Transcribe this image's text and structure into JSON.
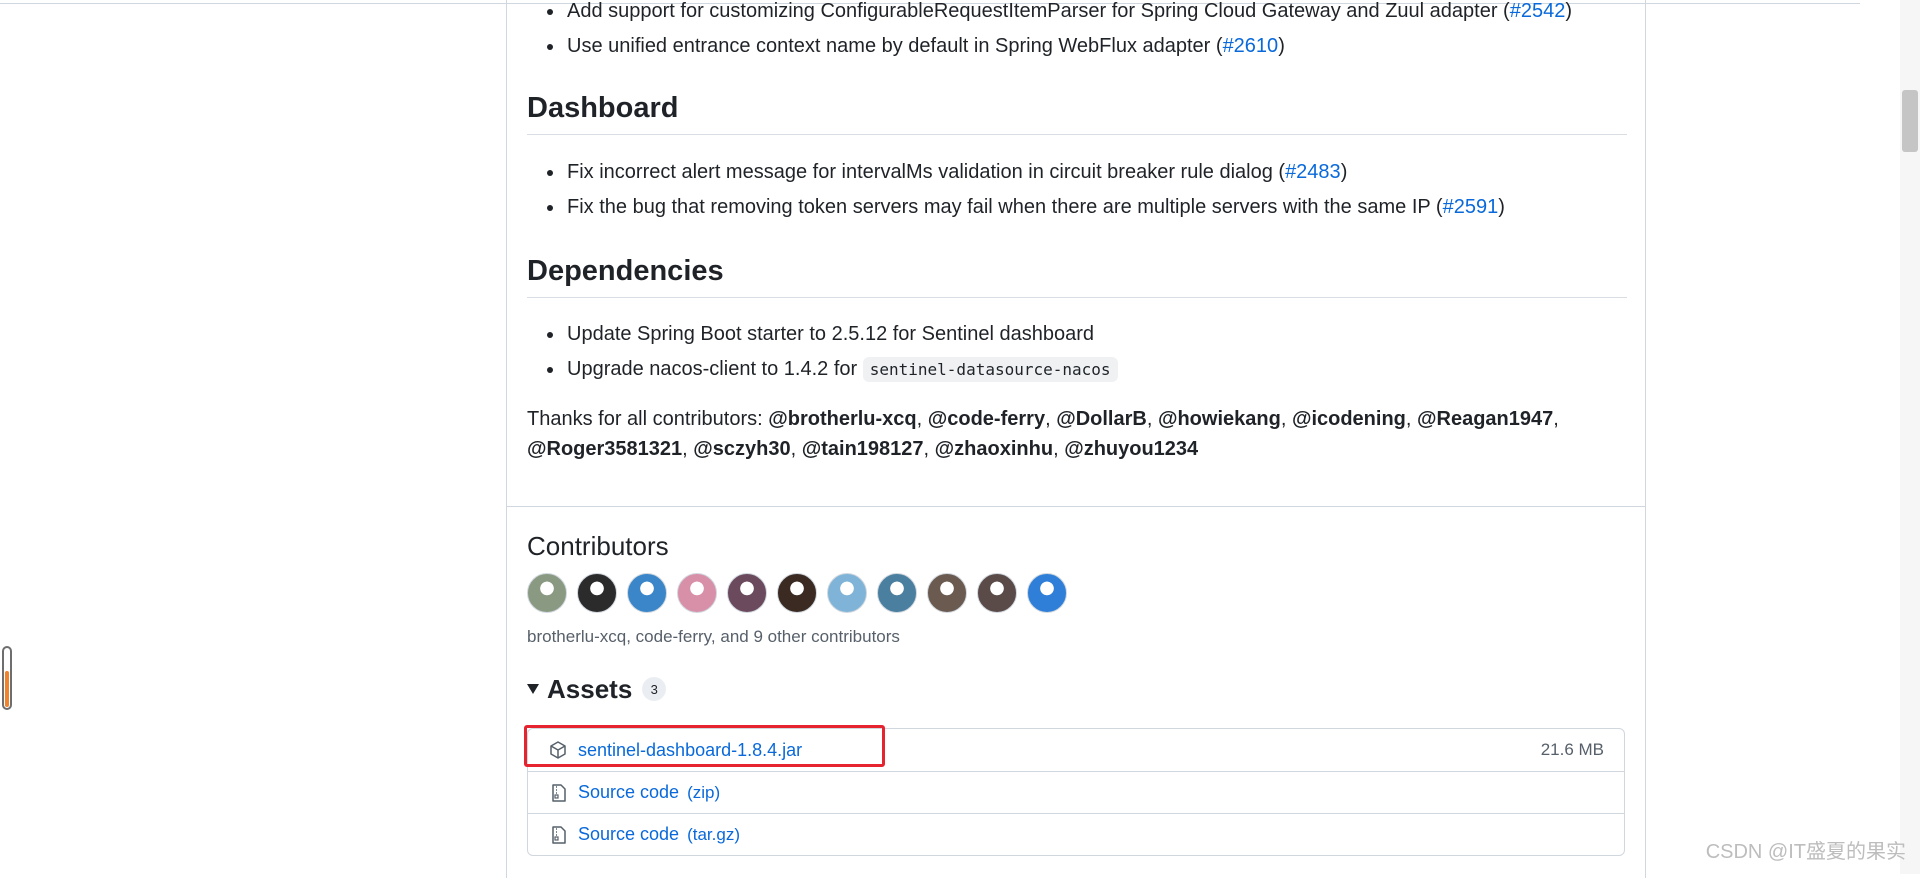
{
  "top_notes": [
    {
      "text": "Add support for customizing ConfigurableRequestItemParser for Spring Cloud Gateway and Zuul adapter (",
      "issue": "#2542",
      "end": ")"
    },
    {
      "text": "Use unified entrance context name by default in Spring WebFlux adapter (",
      "issue": "#2610",
      "end": ")"
    }
  ],
  "dashboard": {
    "heading": "Dashboard",
    "notes": [
      {
        "text": "Fix incorrect alert message for intervalMs validation in circuit breaker rule dialog (",
        "issue": "#2483",
        "end": ")"
      },
      {
        "text": "Fix the bug that removing token servers may fail when there are multiple servers with the same IP (",
        "issue": "#2591",
        "end": ")"
      }
    ]
  },
  "dependencies": {
    "heading": "Dependencies",
    "notes": [
      {
        "text": "Update Spring Boot starter to 2.5.12 for Sentinel dashboard"
      },
      {
        "text": "Upgrade nacos-client to 1.4.2 for ",
        "code": "sentinel-datasource-nacos"
      }
    ]
  },
  "thanks": {
    "prefix": "Thanks for all contributors: ",
    "users": [
      "@brotherlu-xcq",
      "@code-ferry",
      "@DollarB",
      "@howiekang",
      "@icodening",
      "@Reagan1947",
      "@Roger3581321",
      "@sczyh30",
      "@tain198127",
      "@zhaoxinhu",
      "@zhuyou1234"
    ]
  },
  "contributors": {
    "title": "Contributors",
    "avatar_colors": [
      "#8a9a82",
      "#2b2b2b",
      "#3a86c8",
      "#d88fa8",
      "#6b4a5e",
      "#3a2a22",
      "#7fb4d8",
      "#4a7fa0",
      "#6a5a50",
      "#5a4a48",
      "#2f7fd8"
    ],
    "summary": "brotherlu-xcq, code-ferry, and 9 other contributors"
  },
  "assets": {
    "title": "Assets",
    "count": "3",
    "items": [
      {
        "name": "sentinel-dashboard-1.8.4.jar",
        "ext": "",
        "size": "21.6 MB",
        "icon": "package-icon"
      },
      {
        "name": "Source code",
        "ext": "(zip)",
        "size": "",
        "icon": "file-zip-icon"
      },
      {
        "name": "Source code",
        "ext": "(tar.gz)",
        "size": "",
        "icon": "file-zip-icon"
      }
    ]
  },
  "colors": {
    "link": "#0969da",
    "highlight": "#e5242f",
    "border": "#d0d7de"
  },
  "side_widget_level": 0.6,
  "watermark": "CSDN @IT盛夏的果实"
}
